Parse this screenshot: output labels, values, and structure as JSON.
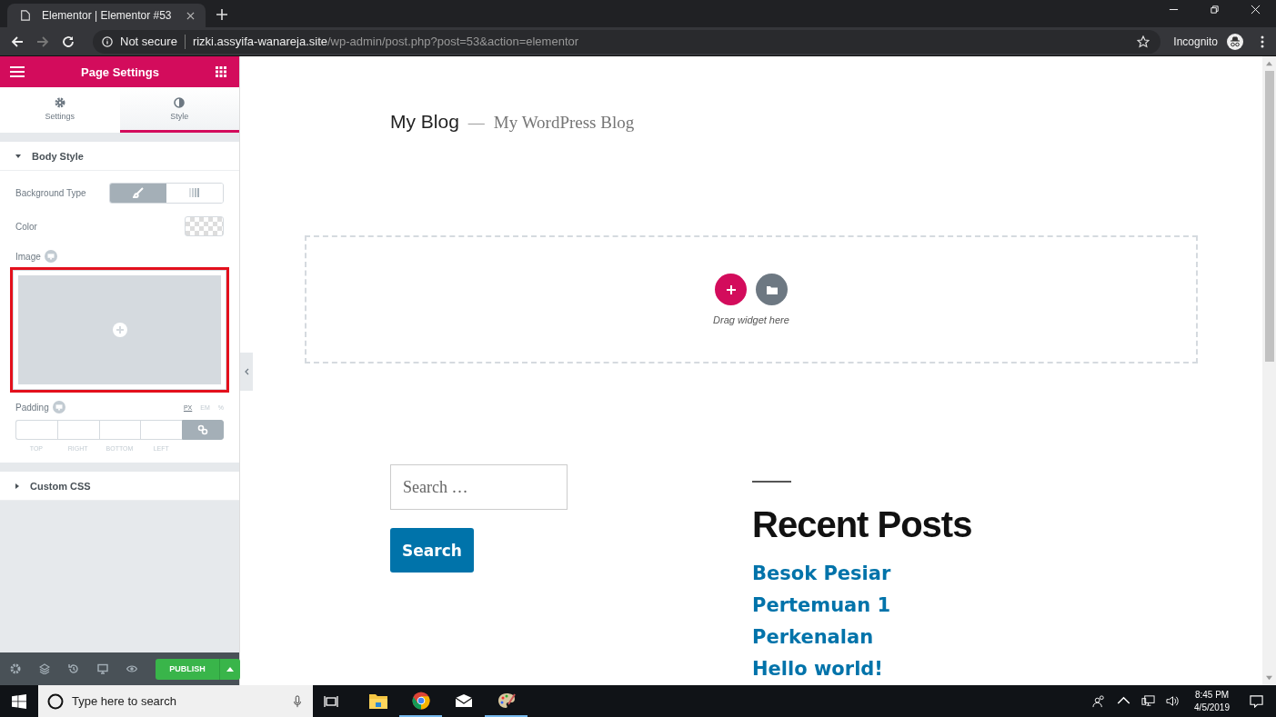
{
  "browser": {
    "tab_title": "Elementor | Elementor #53",
    "security": "Not secure",
    "host": "rizki.assyifa-wanareja.site",
    "path": "/wp-admin/post.php?post=53&action=elementor",
    "profile": "Incognito"
  },
  "sidebar": {
    "title": "Page Settings",
    "tabs": [
      {
        "label": "Settings",
        "kind": "gear",
        "selected": false
      },
      {
        "label": "Style",
        "kind": "contrast",
        "selected": true
      }
    ],
    "sections": [
      {
        "title": "Body Style",
        "expanded": true
      },
      {
        "title": "Custom CSS",
        "expanded": false
      }
    ],
    "background_type": {
      "label": "Background Type",
      "options": [
        {
          "kind": "classic",
          "selected": true
        },
        {
          "kind": "gradient",
          "selected": false
        }
      ]
    },
    "color": {
      "label": "Color"
    },
    "image": {
      "label": "Image",
      "highlighted": true
    },
    "padding": {
      "label": "Padding",
      "units": [
        {
          "label": "PX",
          "selected": true
        },
        {
          "label": "EM",
          "selected": false
        },
        {
          "label": "%",
          "selected": false
        }
      ],
      "sides": [
        "TOP",
        "RIGHT",
        "BOTTOM",
        "LEFT"
      ],
      "linked": true
    },
    "publish": "PUBLISH"
  },
  "page": {
    "site_title": "My Blog",
    "separator": "—",
    "tagline": "My WordPress Blog",
    "drop_hint": "Drag widget here",
    "search_placeholder": "Search …",
    "search_button": "Search",
    "recent_heading": "Recent Posts",
    "posts": [
      "Besok Pesiar",
      "Pertemuan 1",
      "Perkenalan",
      "Hello world!"
    ]
  },
  "taskbar": {
    "search_placeholder": "Type here to search",
    "apps": [
      {
        "kind": "files",
        "active": false
      },
      {
        "kind": "chrome",
        "active": true
      },
      {
        "kind": "mail",
        "active": false
      },
      {
        "kind": "paint",
        "active": true
      }
    ],
    "time": "8:45 PM",
    "date": "4/5/2019"
  }
}
